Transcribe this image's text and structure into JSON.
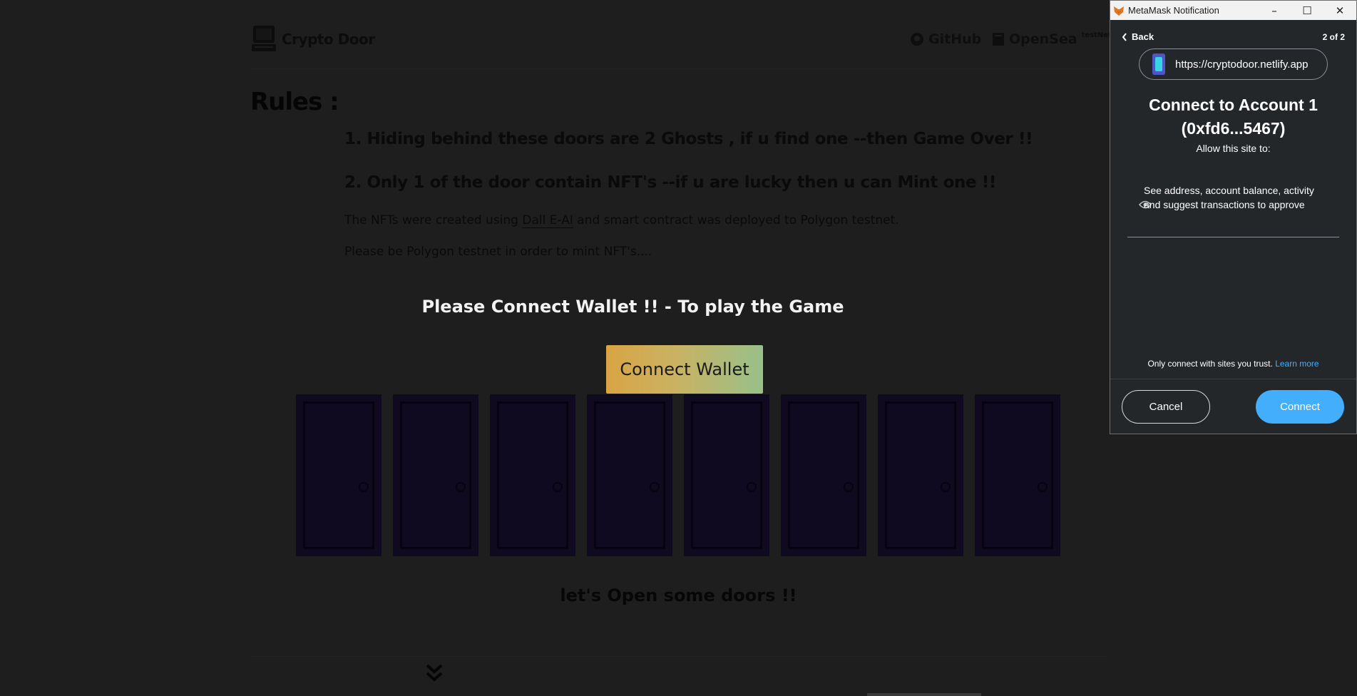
{
  "site": {
    "logo_text": "Crypto Door",
    "nav": [
      {
        "label": "GitHub"
      },
      {
        "label": "OpenSea",
        "badge": "testNet"
      }
    ],
    "rules_title": "Rules :",
    "rules": [
      "1. Hiding behind these doors are 2 Ghosts , if u find one --then Game Over !!",
      "2. Only 1 of the door contain NFT's --if u are lucky then u can Mint one !!"
    ],
    "para1_before": "The NFTs were created using ",
    "para1_link": "Dall E-AI",
    "para1_after": " and smart contract was deployed to Polygon testnet.",
    "para2": "Please be Polygon testnet in order to mint NFT's....",
    "prompt": "Please Connect Wallet !! - To play the Game",
    "connect_button": "Connect Wallet",
    "door_count": 8,
    "lets_open": "let's Open some doors !!"
  },
  "metamask": {
    "window_title": "MetaMask Notification",
    "back_label": "Back",
    "page_count": "2 of 2",
    "url": "https://cryptodoor.netlify.app",
    "heading_line1": "Connect to Account 1",
    "heading_line2": "(0xfd6...5467)",
    "allow_label": "Allow this site to:",
    "permission": "See address, account balance, activity and suggest transactions to approve",
    "trust_text": "Only connect with sites you trust. ",
    "learn_more": "Learn more",
    "cancel_label": "Cancel",
    "connect_label": "Connect",
    "accent_color": "#43aefc"
  }
}
